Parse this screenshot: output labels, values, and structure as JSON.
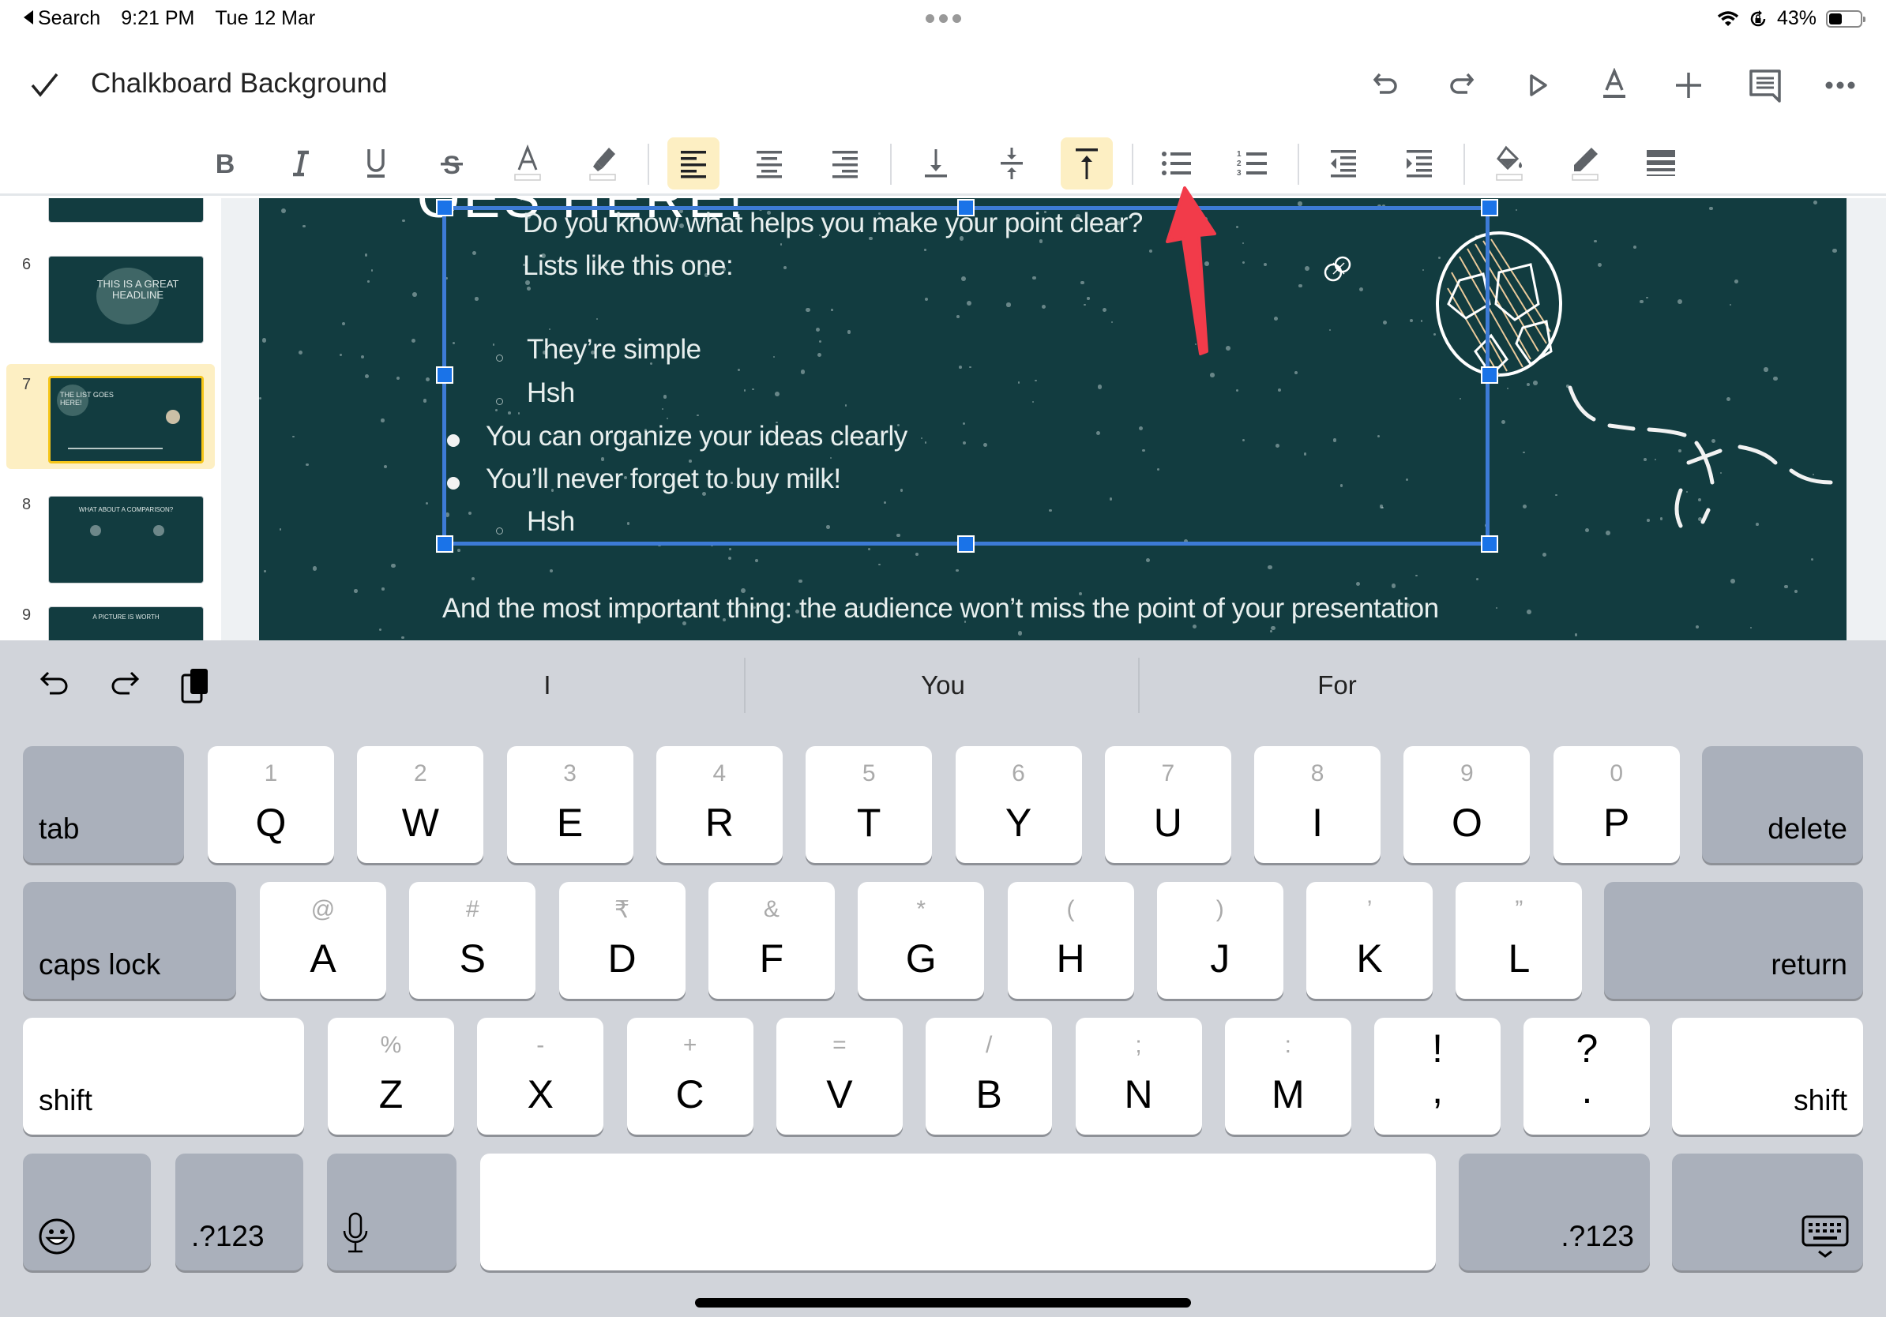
{
  "status_bar": {
    "back_label": "Search",
    "time": "9:21 PM",
    "date": "Tue 12 Mar",
    "battery_percent": "43%",
    "battery_level": 0.43,
    "icons": [
      "wifi-icon",
      "orientation-lock-icon",
      "battery-icon"
    ]
  },
  "titlebar": {
    "done_icon": "checkmark-icon",
    "doc_title": "Chalkboard Background",
    "actions": [
      {
        "name": "undo-button",
        "icon": "undo-icon"
      },
      {
        "name": "redo-button",
        "icon": "redo-icon"
      },
      {
        "name": "present-button",
        "icon": "play-icon"
      },
      {
        "name": "text-format-button",
        "icon": "text-format-icon"
      },
      {
        "name": "insert-button",
        "icon": "plus-icon"
      },
      {
        "name": "comments-button",
        "icon": "comment-icon"
      },
      {
        "name": "more-button",
        "icon": "more-icon"
      }
    ]
  },
  "format_toolbar": {
    "buttons": [
      {
        "name": "bold",
        "glyph": "B",
        "active": false
      },
      {
        "name": "italic",
        "glyph": "I",
        "active": false
      },
      {
        "name": "underline",
        "glyph": "U",
        "active": false
      },
      {
        "name": "strikethrough",
        "glyph": "S",
        "active": false
      },
      {
        "name": "text-color",
        "glyph": "A",
        "active": false
      },
      {
        "name": "highlight-color",
        "active": false
      },
      {
        "name": "align-left",
        "active": true
      },
      {
        "name": "align-center",
        "active": false
      },
      {
        "name": "align-right",
        "active": false
      },
      {
        "name": "vertical-align-bottom",
        "active": false
      },
      {
        "name": "vertical-align-middle",
        "active": false
      },
      {
        "name": "vertical-align-top",
        "active": true
      },
      {
        "name": "bulleted-list",
        "active": false
      },
      {
        "name": "numbered-list",
        "active": false
      },
      {
        "name": "decrease-indent",
        "active": false
      },
      {
        "name": "increase-indent",
        "active": false
      },
      {
        "name": "fill-color",
        "active": false
      },
      {
        "name": "border-color",
        "active": false
      },
      {
        "name": "border-weight",
        "active": false
      }
    ]
  },
  "slides_panel": {
    "thumbs": [
      {
        "number": "",
        "text": ""
      },
      {
        "number": "6",
        "text": "THIS IS A GREAT HEADLINE"
      },
      {
        "number": "7",
        "text": "THE LIST GOES HERE!",
        "selected": true
      },
      {
        "number": "8",
        "text": "WHAT ABOUT A COMPARISON?"
      },
      {
        "number": "9",
        "text": "A PICTURE IS WORTH"
      }
    ]
  },
  "slide": {
    "title_fragment": "OES HERE!",
    "intro_lines": [
      "Do you know what helps you make your point clear?",
      "Lists like this one:"
    ],
    "list_items": [
      {
        "text": "They’re simple",
        "level": 2
      },
      {
        "text": "Hsh",
        "level": 2
      },
      {
        "text": "You can organize your ideas clearly",
        "level": 1
      },
      {
        "text": "You’ll never forget to buy milk!",
        "level": 1
      },
      {
        "text": "Hsh",
        "level": 2
      }
    ],
    "footer_text": "And the most important thing: the audience won’t miss the point of your presentation",
    "colors": {
      "background": "#123c40",
      "selection": "#3d7bd6",
      "handle": "#1a73e8",
      "annotation_arrow": "#f23b4a"
    }
  },
  "keyboard": {
    "predictions": [
      "I",
      "You",
      "For"
    ],
    "shortcut_icons": [
      "undo-icon",
      "redo-icon",
      "paste-icon"
    ],
    "row1": [
      {
        "alt": "1",
        "key": "Q"
      },
      {
        "alt": "2",
        "key": "W"
      },
      {
        "alt": "3",
        "key": "E"
      },
      {
        "alt": "4",
        "key": "R"
      },
      {
        "alt": "5",
        "key": "T"
      },
      {
        "alt": "6",
        "key": "Y"
      },
      {
        "alt": "7",
        "key": "U"
      },
      {
        "alt": "8",
        "key": "I"
      },
      {
        "alt": "9",
        "key": "O"
      },
      {
        "alt": "0",
        "key": "P"
      }
    ],
    "row2": [
      {
        "alt": "@",
        "key": "A"
      },
      {
        "alt": "#",
        "key": "S"
      },
      {
        "alt": "₹",
        "key": "D"
      },
      {
        "alt": "&",
        "key": "F"
      },
      {
        "alt": "*",
        "key": "G"
      },
      {
        "alt": "(",
        "key": "H"
      },
      {
        "alt": ")",
        "key": "J"
      },
      {
        "alt": "’",
        "key": "K"
      },
      {
        "alt": "”",
        "key": "L"
      }
    ],
    "row3": [
      {
        "alt": "%",
        "key": "Z"
      },
      {
        "alt": "-",
        "key": "X"
      },
      {
        "alt": "+",
        "key": "C"
      },
      {
        "alt": "=",
        "key": "V"
      },
      {
        "alt": "/",
        "key": "B"
      },
      {
        "alt": ";",
        "key": "N"
      },
      {
        "alt": ":",
        "key": "M"
      },
      {
        "alt": "!",
        "key": ","
      },
      {
        "alt": "?",
        "key": "."
      }
    ],
    "tab_label": "tab",
    "delete_label": "delete",
    "caps_label": "caps lock",
    "return_label": "return",
    "shift_label": "shift",
    "numbers_label": ".?123"
  }
}
